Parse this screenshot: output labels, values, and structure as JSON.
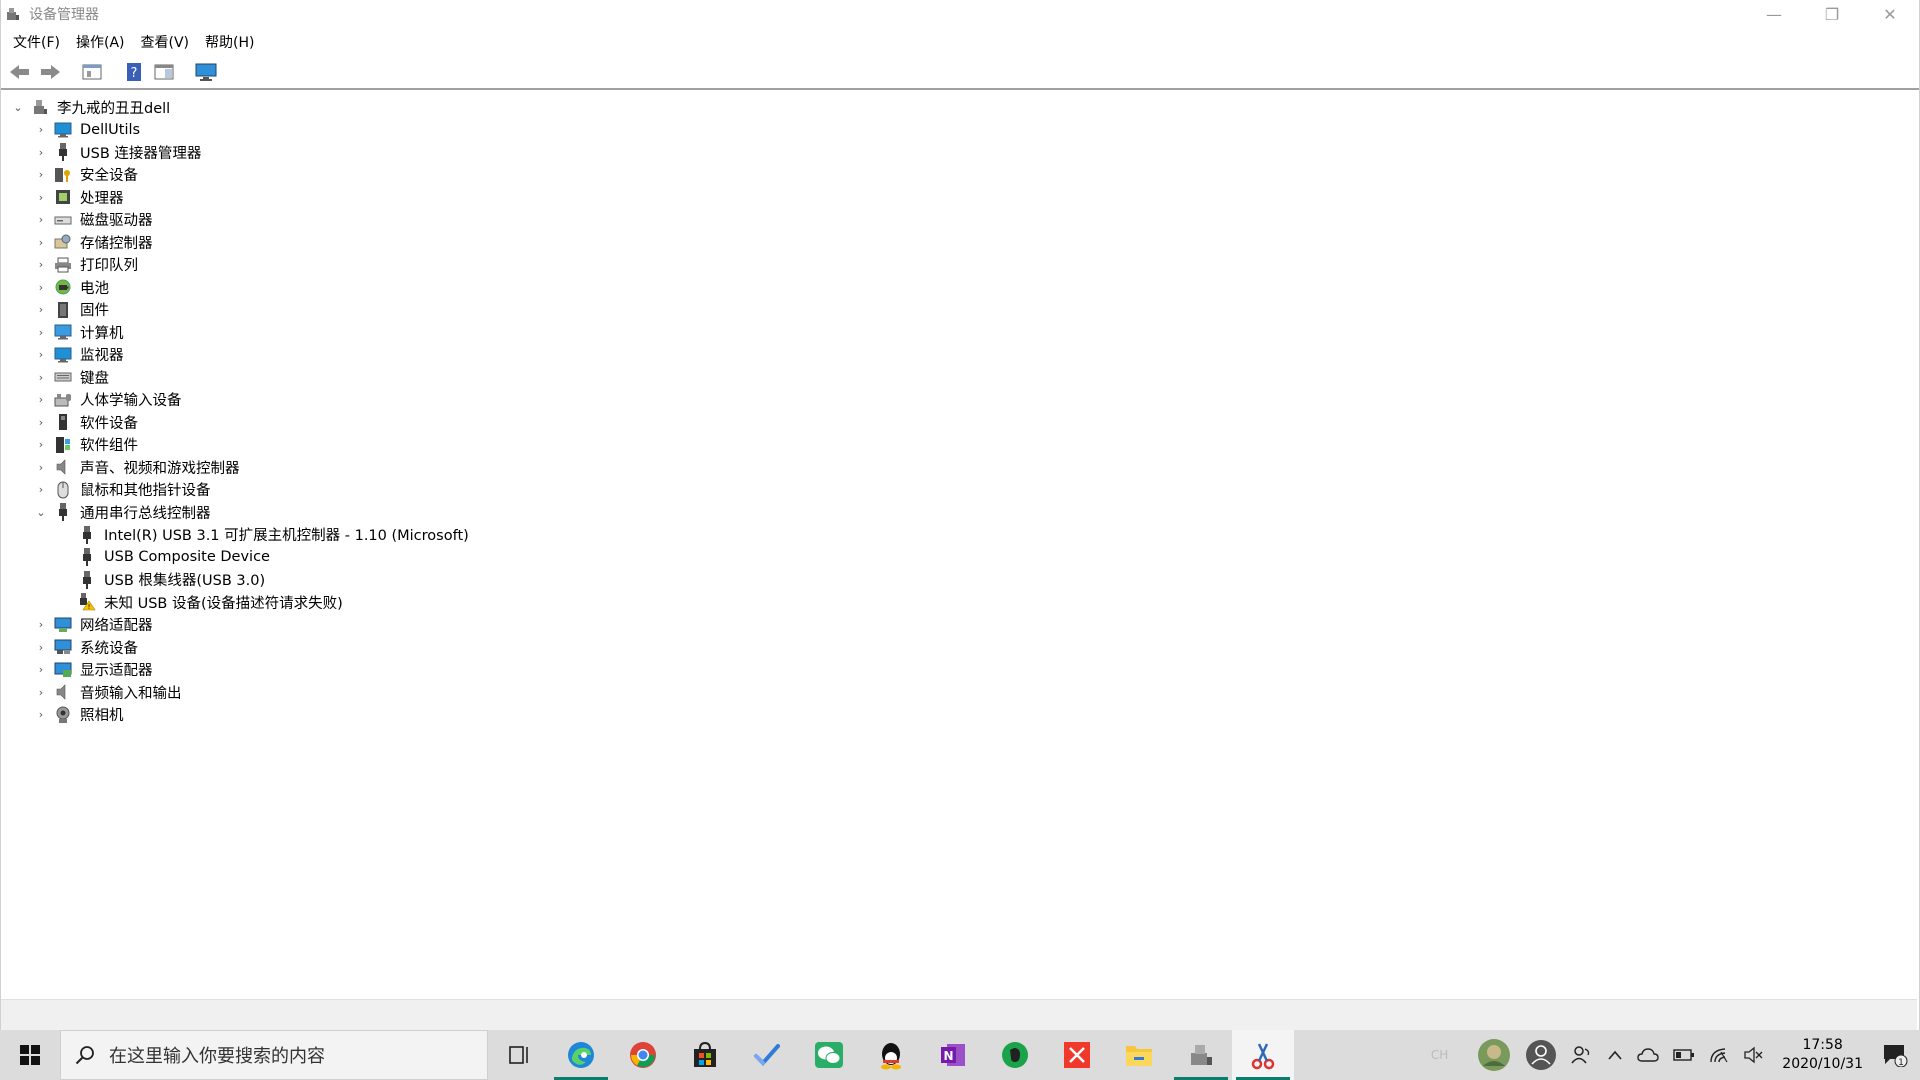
{
  "window": {
    "title": "设备管理器",
    "controls": {
      "minimize": "—",
      "restore": "❐",
      "close": "✕"
    }
  },
  "menu": [
    {
      "label": "文件(F)"
    },
    {
      "label": "操作(A)"
    },
    {
      "label": "查看(V)"
    },
    {
      "label": "帮助(H)"
    }
  ],
  "toolbar": {
    "icons": [
      "back-arrow-icon",
      "forward-arrow-icon",
      "properties-icon",
      "help-icon",
      "details-pane-icon",
      "monitor-scan-icon"
    ]
  },
  "tree": {
    "root": {
      "label": "李九戒的丑丑dell",
      "expander": "⌄"
    },
    "collapsed_glyph": "›",
    "expanded_glyph": "⌄",
    "categories": [
      {
        "label": "DellUtils",
        "icon": "monitor-icon"
      },
      {
        "label": "USB 连接器管理器",
        "icon": "usb-icon"
      },
      {
        "label": "安全设备",
        "icon": "security-key-icon"
      },
      {
        "label": "处理器",
        "icon": "processor-icon"
      },
      {
        "label": "磁盘驱动器",
        "icon": "disk-drive-icon"
      },
      {
        "label": "存储控制器",
        "icon": "storage-controller-icon"
      },
      {
        "label": "打印队列",
        "icon": "printer-icon"
      },
      {
        "label": "电池",
        "icon": "battery-icon"
      },
      {
        "label": "固件",
        "icon": "firmware-icon"
      },
      {
        "label": "计算机",
        "icon": "computer-icon"
      },
      {
        "label": "监视器",
        "icon": "monitor-icon"
      },
      {
        "label": "键盘",
        "icon": "keyboard-icon"
      },
      {
        "label": "人体学输入设备",
        "icon": "hid-icon"
      },
      {
        "label": "软件设备",
        "icon": "software-device-icon"
      },
      {
        "label": "软件组件",
        "icon": "software-component-icon"
      },
      {
        "label": "声音、视频和游戏控制器",
        "icon": "speaker-icon"
      },
      {
        "label": "鼠标和其他指针设备",
        "icon": "mouse-icon"
      }
    ],
    "usb_category": {
      "label": "通用串行总线控制器",
      "icon": "usb-icon",
      "children": [
        {
          "label": "Intel(R) USB 3.1 可扩展主机控制器 - 1.10 (Microsoft)",
          "icon": "usb-icon"
        },
        {
          "label": "USB Composite Device",
          "icon": "usb-icon"
        },
        {
          "label": "USB 根集线器(USB 3.0)",
          "icon": "usb-icon"
        },
        {
          "label": "未知 USB 设备(设备描述符请求失败)",
          "icon": "usb-warning-icon"
        }
      ]
    },
    "categories_after": [
      {
        "label": "网络适配器",
        "icon": "network-adapter-icon"
      },
      {
        "label": "系统设备",
        "icon": "system-device-icon"
      },
      {
        "label": "显示适配器",
        "icon": "display-adapter-icon"
      },
      {
        "label": "音频输入和输出",
        "icon": "speaker-icon"
      },
      {
        "label": "照相机",
        "icon": "camera-icon"
      }
    ]
  },
  "taskbar": {
    "search_placeholder": "在这里输入你要搜索的内容",
    "apps": [
      "task-view-icon",
      "edge-icon",
      "chrome-icon",
      "store-icon",
      "todo-icon",
      "wechat-icon",
      "qq-icon",
      "onenote-icon",
      "evernote-icon",
      "xmind-icon",
      "file-explorer-icon",
      "device-manager-icon",
      "snipping-icon"
    ],
    "ime": "CH",
    "time": "17:58",
    "date": "2020/10/31",
    "notifications": "1"
  },
  "colors": {
    "accent": "#0a7d6c",
    "monitor_blue": "#1f8fd6",
    "warning_yellow": "#f5c400"
  }
}
